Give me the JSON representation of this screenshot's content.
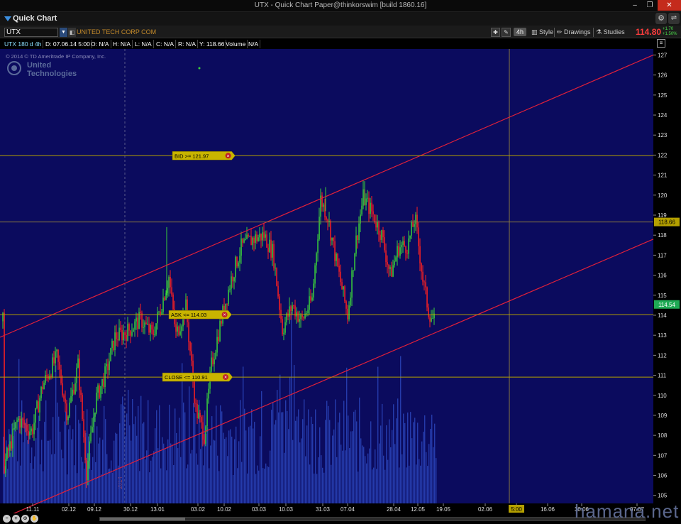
{
  "window": {
    "title": "UTX - Quick Chart Paper@thinkorswim [build 1860.16]",
    "min_glyph": "–",
    "max_glyph": "❐",
    "close_glyph": "✕"
  },
  "header": {
    "title": "Quick Chart",
    "gear_glyph": "⚙",
    "link_glyph": "⇌"
  },
  "toolbar": {
    "symbol": "UTX",
    "company": "UNITED TECH CORP COM",
    "timeframe": "4h",
    "style_label": "Style",
    "drawings_label": "Drawings",
    "studies_label": "Studies",
    "last_price": "114.80",
    "change_abs": "+1.70",
    "change_pct": "+1.50%",
    "icon_names": [
      "crosshair-icon",
      "pencil-icon"
    ]
  },
  "info_row": {
    "cells": [
      "UTX 180 d 4h",
      "D: 07.06.14 5:00",
      "O: N/A",
      "H: N/A",
      "L: N/A",
      "C: N/A",
      "R: N/A",
      "Y: 118.66",
      "Volume",
      "N/A"
    ]
  },
  "chart": {
    "copyright": "© 2014 © TD Ameritrade IP Company, Inc.",
    "logo_line1": "United",
    "logo_line2": "Technologies",
    "price_axis": [
      "127",
      "126",
      "125",
      "124",
      "123",
      "122",
      "121",
      "120",
      "119",
      "118",
      "117",
      "116",
      "115",
      "114",
      "113",
      "112",
      "111",
      "110",
      "109",
      "108",
      "107",
      "106",
      "105"
    ],
    "price_range": [
      104.6,
      127.3
    ],
    "date_labels": [
      "11.11",
      "02.12",
      "09.12",
      "30.12",
      "13.01",
      "03.02",
      "10.02",
      "03.03",
      "10.03",
      "31.03",
      "07.04",
      "28.04",
      "12.05",
      "19.05",
      "02.06",
      "5:00",
      "16.06",
      "30.06",
      "07.07"
    ],
    "year_marker": "2014",
    "horizontal_levels": [
      {
        "label": "BID >= 121.97",
        "price": 121.97
      },
      {
        "label": "ASK <= 114.03",
        "price": 114.03
      },
      {
        "label": "CLOSE <= 110.91",
        "price": 110.91
      }
    ],
    "crosshair_price": "118.66",
    "crosshair_value": 118.66,
    "current_price_tag": "114.54",
    "current_price_value": 114.54,
    "trend_channel": {
      "upper": {
        "start": 112.9,
        "end": 127.0
      },
      "lower": {
        "start": 103.8,
        "end": 117.8
      }
    },
    "colors": {
      "background": "#0b0b5e",
      "up_candle": "#3bd13b",
      "down_candle": "#ff2020",
      "trend_line": "#e0203a",
      "level_line": "#b5a000",
      "volume": "#2a44b8"
    }
  },
  "watermark": "hamana.net"
}
